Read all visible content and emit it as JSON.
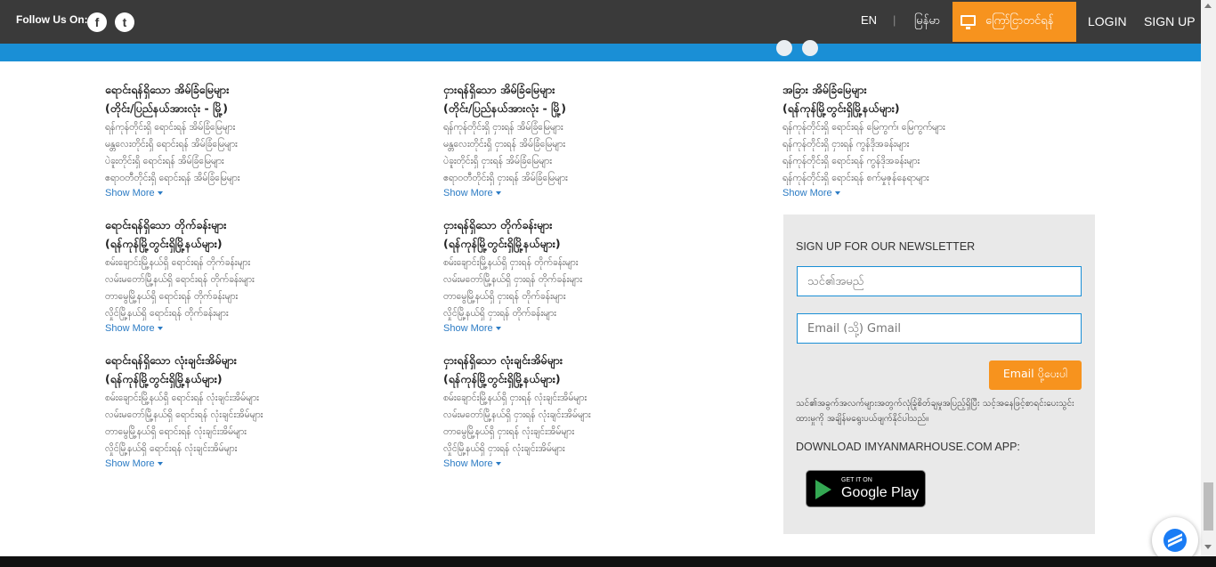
{
  "header": {
    "follow_label": "Follow Us On:",
    "social": [
      {
        "icon": "facebook-icon",
        "glyph": "f"
      },
      {
        "icon": "twitter-icon",
        "glyph": "t"
      }
    ],
    "lang_en": "EN",
    "lang_sep": "|",
    "lang_my": "မြန်မာ",
    "post_button": "ကြော်ငြာတင်ရန်",
    "login": "LOGIN",
    "signup": "SIGN UP"
  },
  "columns": [
    {
      "blocks": [
        {
          "title1": "ရောင်းရန်ရှိသော အိမ်ခြံမြေများ",
          "title2": "(တိုင်း/ပြည်နယ်အားလုံး - မြို့)",
          "items": [
            "ရန်ကုန်တိုင်းရှိ ရောင်းရန် အိမ်ခြံမြေများ",
            "မန္တလေးတိုင်းရှိ ရောင်းရန် အိမ်ခြံမြေများ",
            "ပဲခူးတိုင်းရှိ ရောင်းရန် အိမ်ခြံမြေများ",
            "ဧရာဝတီတိုင်းရှိ ရောင်းရန် အိမ်ခြံမြေများ"
          ],
          "more": "Show More"
        },
        {
          "title1": "ရောင်းရန်ရှိသော တိုက်ခန်းများ",
          "title2": "(ရန်ကုန်မြို့တွင်းရှိမြို့နယ်များ)",
          "items": [
            "စမ်းချောင်းမြို့နယ်ရှိ ရောင်းရန် တိုက်ခန်းများ",
            "လမ်းမတော်မြို့နယ်ရှိ ရောင်းရန် တိုက်ခန်းများ",
            "တာမွေမြို့နယ်ရှိ ရောင်းရန် တိုက်ခန်းများ",
            "လှိုင်မြို့နယ်ရှိ ရောင်းရန် တိုက်ခန်းများ"
          ],
          "more": "Show More"
        },
        {
          "title1": "ရောင်းရန်ရှိသော လုံးချင်းအိမ်များ",
          "title2": "(ရန်ကုန်မြို့တွင်းရှိမြို့နယ်များ)",
          "items": [
            "စမ်းချောင်းမြို့နယ်ရှိ ရောင်းရန် လုံးချင်းအိမ်များ",
            "လမ်းမတော်မြို့နယ်ရှိ ရောင်းရန် လုံးချင်းအိမ်များ",
            "တာမွေမြို့နယ်ရှိ ရောင်းရန် လုံးချင်းအိမ်များ",
            "လှိုင်မြို့နယ်ရှိ ရောင်းရန် လုံးချင်းအိမ်များ"
          ],
          "more": "Show More"
        }
      ]
    },
    {
      "blocks": [
        {
          "title1": "ငှားရန်ရှိသော အိမ်ခြံမြေများ",
          "title2": "(တိုင်း/ပြည်နယ်အားလုံး - မြို့)",
          "items": [
            "ရန်ကုန်တိုင်းရှိ ငှားရန် အိမ်ခြံမြေများ",
            "မန္တလေးတိုင်းရှိ ငှားရန် အိမ်ခြံမြေများ",
            "ပဲခူးတိုင်းရှိ ငှားရန် အိမ်ခြံမြေများ",
            "ဧရာဝတီတိုင်းရှိ ငှားရန် အိမ်ခြံမြေများ"
          ],
          "more": "Show More"
        },
        {
          "title1": "ငှားရန်ရှိသော တိုက်ခန်းများ",
          "title2": "(ရန်ကုန်မြို့တွင်းရှိမြို့နယ်များ)",
          "items": [
            "စမ်းချောင်းမြို့နယ်ရှိ ငှားရန် တိုက်ခန်းများ",
            "လမ်းမတော်မြို့နယ်ရှိ ငှားရန် တိုက်ခန်းများ",
            "တာမွေမြို့နယ်ရှိ ငှားရန် တိုက်ခန်းများ",
            "လှိုင်မြို့နယ်ရှိ ငှားရန် တိုက်ခန်းများ"
          ],
          "more": "Show More"
        },
        {
          "title1": "ငှားရန်ရှိသော လုံးချင်းအိမ်များ",
          "title2": "(ရန်ကုန်မြို့တွင်းရှိမြို့နယ်များ)",
          "items": [
            "စမ်းချောင်းမြို့နယ်ရှိ ငှားရန် လုံးချင်းအိမ်များ",
            "လမ်းမတော်မြို့နယ်ရှိ ငှားရန် လုံးချင်းအိမ်များ",
            "တာမွေမြို့နယ်ရှိ ငှားရန် လုံးချင်းအိမ်များ",
            "လှိုင်မြို့နယ်ရှိ ငှားရန် လုံးချင်းအိမ်များ"
          ],
          "more": "Show More"
        }
      ]
    },
    {
      "blocks": [
        {
          "title1": "အခြား အိမ်ခြံမြေများ",
          "title2": "(ရန်ကုန်မြို့တွင်းရှိမြို့နယ်များ)",
          "items": [
            "ရန်ကုန်တိုင်းရှိ ရောင်းရန် မြေကွက်၊ မြေကွက်များ",
            "ရန်ကုန်တိုင်းရှိ ငှားရန် ကွန်ဒိုအခန်းများ",
            "ရန်ကုန်တိုင်းရှိ ရောင်းရန် ကွန်ဒိုအခန်းများ",
            "ရန်ကုန်တိုင်းရှိ ရောင်းရန် စက်မှုဇုန်နေရာများ"
          ],
          "more": "Show More"
        }
      ]
    }
  ],
  "newsletter": {
    "title": "SIGN UP FOR OUR NEWSLETTER",
    "name_placeholder": "သင်၏အမည်",
    "email_placeholder": "Email (သို့) Gmail",
    "send_button": "Email ပို့ပေးပါ",
    "description": "သင်၏အခွက်အလက်များအတွက်လုံခြုံစိတ်ချမှုအပြည့်ရှိပြီး သင့်အနေဖြင့်စာရင်းပေးသွင်းထားမှုကို အချိန်မရွေးပယ်ဖျက်နိုင်ပါသည်။",
    "download_label": "DOWNLOAD IMYANMARHOUSE.COM APP:",
    "gp_top": "GET IT ON",
    "gp_big": "Google Play"
  }
}
